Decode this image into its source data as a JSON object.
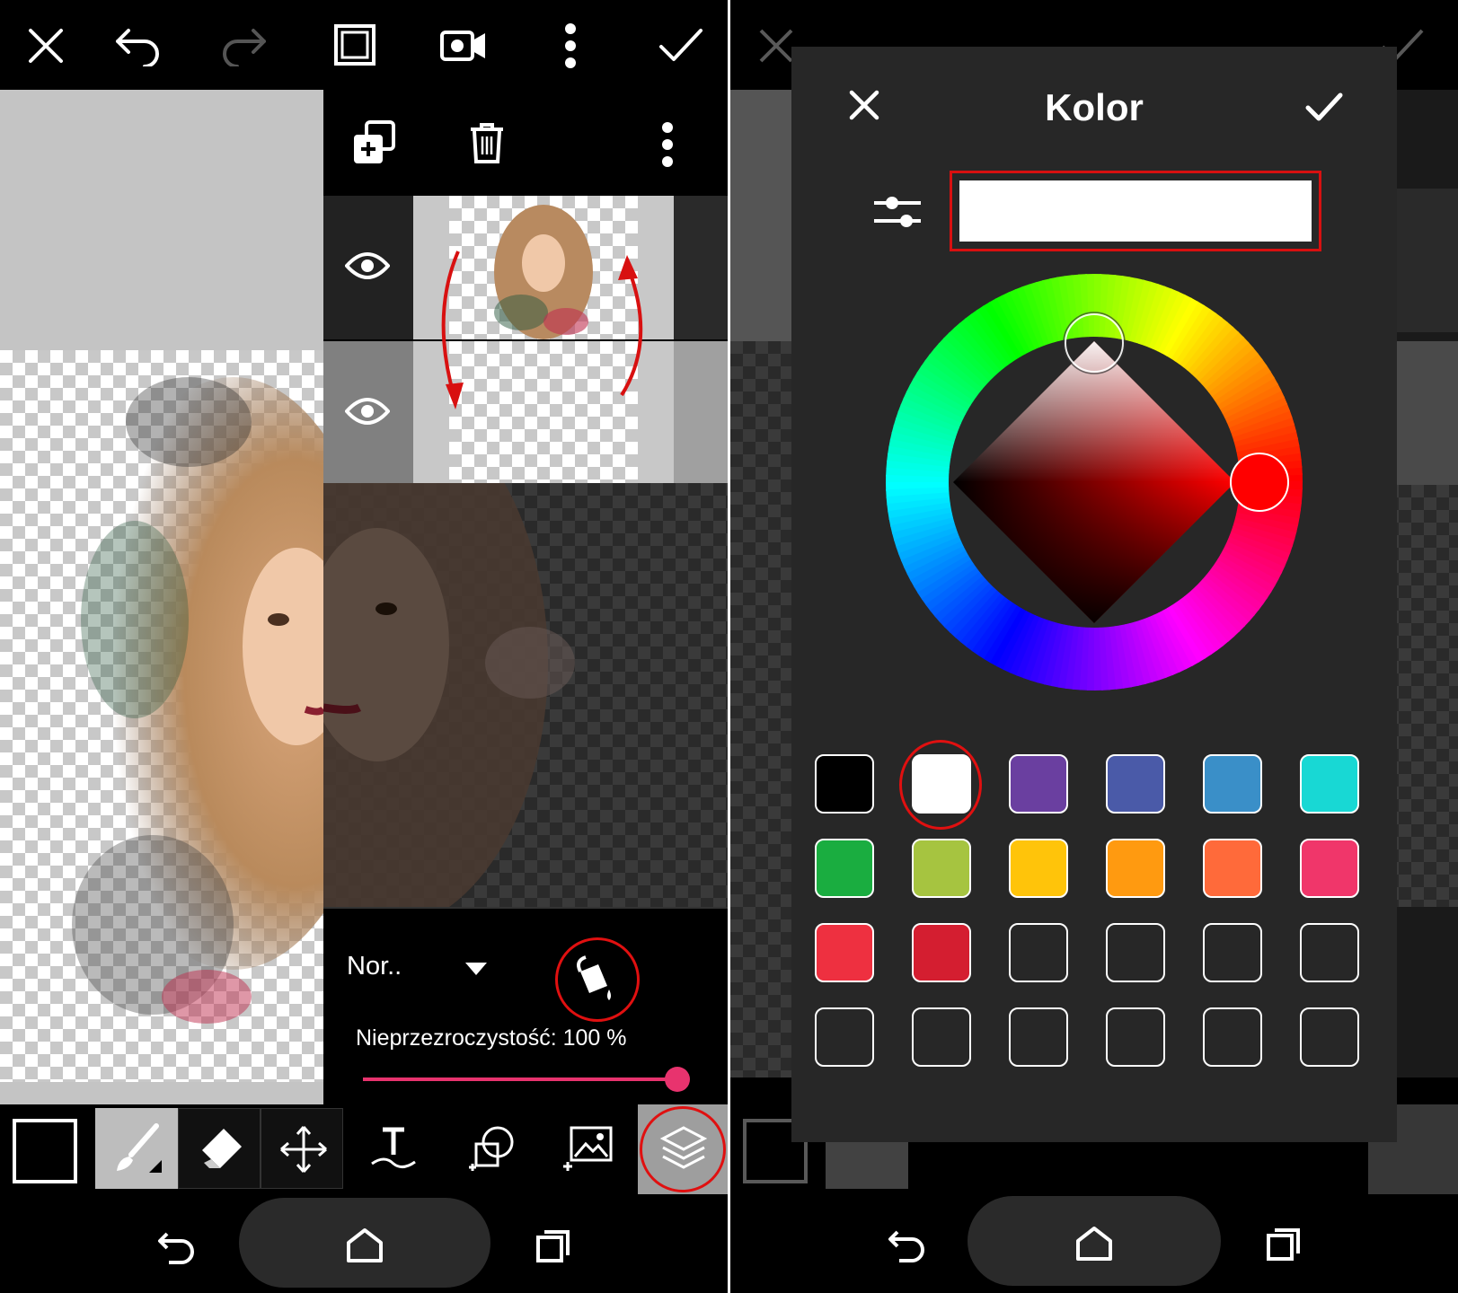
{
  "left_panel": {
    "top_toolbar": {
      "close_icon": "close-icon",
      "undo_icon": "undo-icon",
      "redo_icon": "redo-icon",
      "fullscreen_icon": "fullscreen-icon",
      "video_icon": "video-icon",
      "more_icon": "more-vertical-icon",
      "apply_icon": "check-icon"
    },
    "layers_panel": {
      "add_layer_icon": "add-layer-icon",
      "delete_icon": "trash-icon",
      "more_icon": "more-vertical-icon",
      "layers": [
        {
          "visibility_icon": "eye-icon"
        },
        {
          "visibility_icon": "eye-icon"
        }
      ],
      "blend_mode": "Nor..",
      "opacity_label": "Nieprzezroczystość: 100 %",
      "opacity_value": 100
    },
    "bottom_tools": [
      "color-swatch",
      "brush-icon",
      "eraser-icon",
      "move-icon",
      "text-icon",
      "shape-icon",
      "image-icon",
      "layers-icon"
    ],
    "nav": [
      "back-icon",
      "home-icon",
      "recents-icon"
    ]
  },
  "color_dialog": {
    "title": "Kolor",
    "close_icon": "close-icon",
    "confirm_icon": "check-icon",
    "settings_icon": "sliders-icon",
    "current_color": "#ffffff",
    "hue_color": "#ff0000",
    "swatches": [
      "#000000",
      "#ffffff",
      "#6a3fa0",
      "#4a5aa8",
      "#3a8fc8",
      "#18d8d4",
      "#1aad40",
      "#a6c440",
      "#ffc40a",
      "#ff9a10",
      "#ff6a3a",
      "#f0366a",
      "#ee3040",
      "#d41e30",
      "",
      "",
      "",
      "",
      "",
      "",
      "",
      "",
      "",
      ""
    ],
    "selected_swatch_index": 1
  },
  "accent_color": "#e8336e"
}
